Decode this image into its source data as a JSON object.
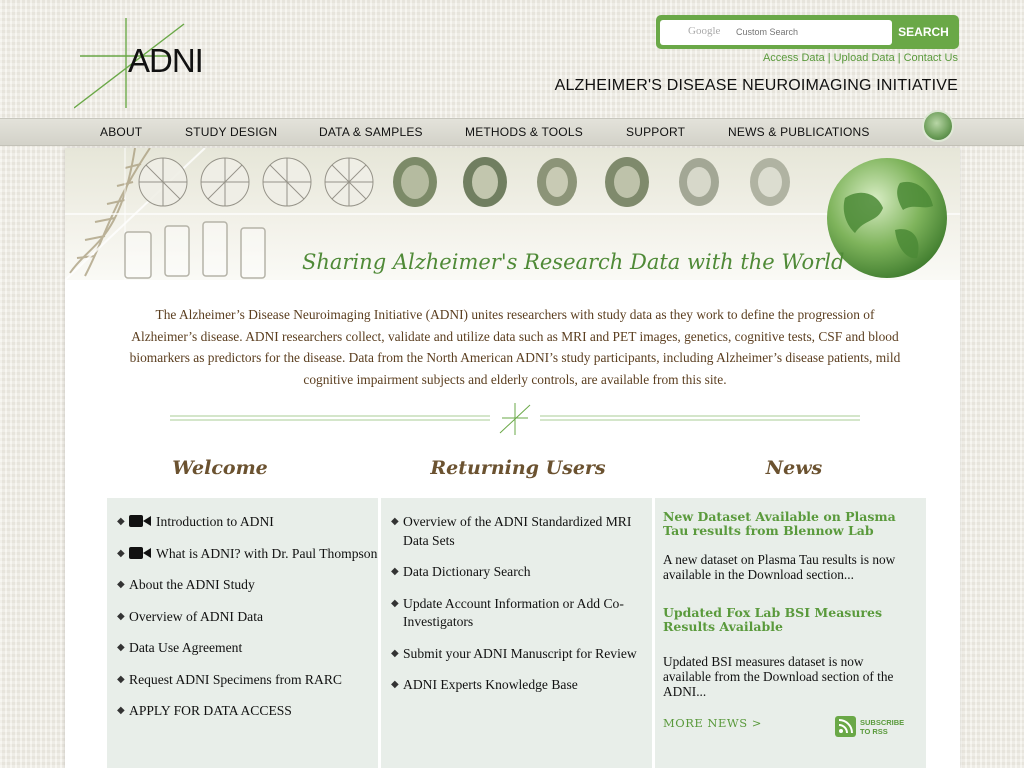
{
  "header": {
    "logo_text": "ADNI",
    "search_placeholder": "Custom Search",
    "search_brand": "Google",
    "search_button": "SEARCH",
    "util_links": [
      "Access Data",
      "Upload Data",
      "Contact Us"
    ],
    "tagline": "ALZHEIMER'S DISEASE NEUROIMAGING INITIATIVE"
  },
  "nav": {
    "items": [
      "ABOUT",
      "STUDY DESIGN",
      "DATA & SAMPLES",
      "METHODS & TOOLS",
      "SUPPORT",
      "NEWS & PUBLICATIONS"
    ]
  },
  "banner": {
    "title": "Sharing Alzheimer's Research Data with the World"
  },
  "intro": "The Alzheimer’s Disease Neuroimaging Initiative (ADNI) unites researchers with study data as they work to define the progression of Alzheimer’s disease. ADNI researchers collect, validate and utilize data such as MRI and PET images, genetics, cognitive tests, CSF and blood biomarkers as predictors for the disease. Data from the North American ADNI’s study participants, including Alzheimer’s disease patients, mild cognitive impairment subjects and elderly controls, are available from this site.",
  "welcome": {
    "title": "Welcome",
    "items": [
      "Introduction to ADNI",
      "What is ADNI? with Dr. Paul Thompson",
      "About the ADNI Study",
      "Overview of ADNI Data",
      "Data Use Agreement",
      "Request ADNI Specimens from RARC",
      "APPLY FOR DATA ACCESS"
    ]
  },
  "returning": {
    "title": "Returning Users",
    "items": [
      "Overview of the ADNI Standardized MRI Data Sets",
      "Data Dictionary Search",
      "Update Account Information or Add Co-Investigators",
      "Submit your ADNI Manuscript for Review",
      "ADNI Experts Knowledge Base"
    ]
  },
  "news": {
    "title": "News",
    "items": [
      {
        "headline": "New Dataset Available on Plasma Tau results from Blennow Lab",
        "body": "A new dataset on Plasma Tau results is now available in the Download section..."
      },
      {
        "headline": "Updated Fox Lab BSI Measures Results Available",
        "body": "Updated BSI measures dataset is now available from the Download section of the ADNI..."
      }
    ],
    "more_label": "MORE NEWS >",
    "rss_line1": "SUBSCRIBE",
    "rss_line2": "TO RSS"
  },
  "colors": {
    "accent_green": "#5a9a3c",
    "heading_brown": "#6b5230",
    "intro_brown": "#5b3e1f",
    "column_bg": "#e8eee9"
  }
}
